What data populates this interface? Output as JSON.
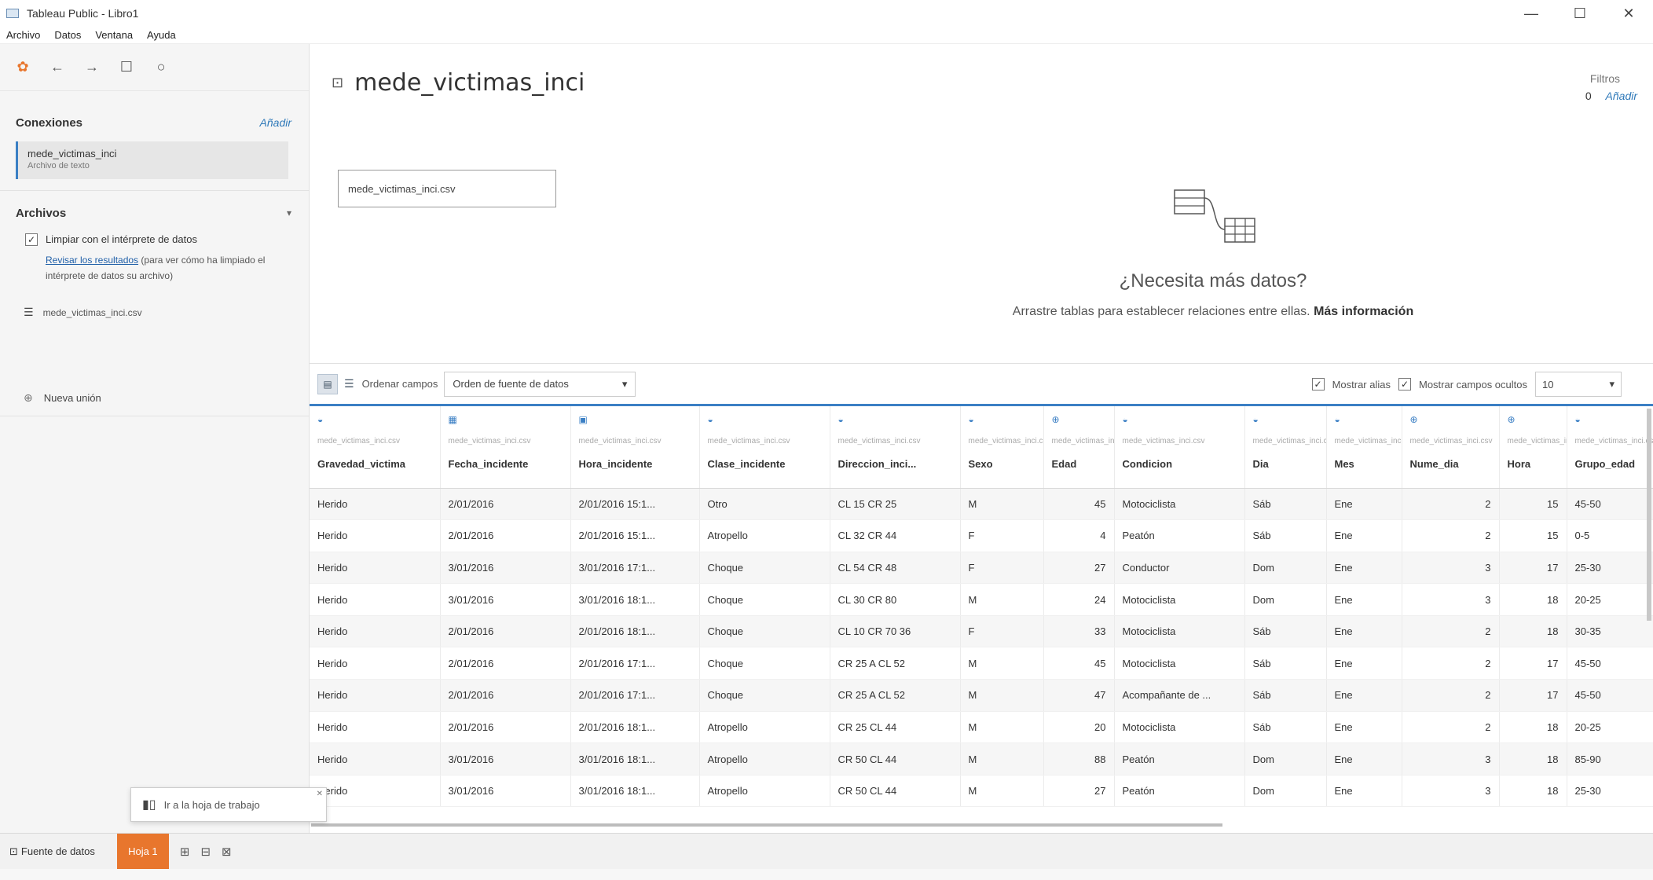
{
  "window": {
    "title": "Tableau Public - Libro1",
    "controls": [
      "—",
      "☐",
      "✕"
    ]
  },
  "menu": [
    "Archivo",
    "Datos",
    "Ventana",
    "Ayuda"
  ],
  "left": {
    "toolbar_icons": [
      "tableau-logo-icon",
      "undo-icon",
      "redo-icon",
      "save-icon",
      "refresh-icon"
    ],
    "connections_title": "Conexiones",
    "connections_add": "Añadir",
    "connection_name": "mede_victimas_inci",
    "connection_sub": "Archivo de texto",
    "files_title": "Archivos",
    "interpreter_label": "Limpiar con el intérprete de datos",
    "interpreter_hint_link": "Revisar los resultados",
    "interpreter_hint_text": " (para ver cómo ha limpiado el intérprete de datos su archivo)",
    "file_item": "mede_victimas_inci.csv",
    "new_union": "Nueva unión"
  },
  "main": {
    "title": "mede_victimas_inci",
    "filters_label": "Filtros",
    "filters_count": "0",
    "filters_add": "Añadir",
    "table_box": "mede_victimas_inci.csv",
    "need_title": "¿Necesita más datos?",
    "need_text": "Arrastre tablas para establecer relaciones entre ellas. ",
    "need_link": "Más información"
  },
  "gridbar": {
    "sort_label": "Ordenar campos",
    "sort_value": "Orden de fuente de datos",
    "show_aliases": "Mostrar alias",
    "show_hidden": "Mostrar campos ocultos",
    "rows_value": "10"
  },
  "grid": {
    "columns": [
      {
        "icon": "abc",
        "source": "mede_victimas_inci.csv",
        "name": "Gravedad_victima"
      },
      {
        "icon": "date",
        "source": "mede_victimas_inci.csv",
        "name": "Fecha_incidente"
      },
      {
        "icon": "datetime",
        "source": "mede_victimas_inci.csv",
        "name": "Hora_incidente"
      },
      {
        "icon": "abc",
        "source": "mede_victimas_inci.csv",
        "name": "Clase_incidente"
      },
      {
        "icon": "abc",
        "source": "mede_victimas_inci.csv",
        "name": "Direccion_inci..."
      },
      {
        "icon": "abc",
        "source": "mede_victimas_inci.csv",
        "name": "Sexo"
      },
      {
        "icon": "#",
        "source": "mede_victimas_inci.csv",
        "name": "Edad"
      },
      {
        "icon": "abc",
        "source": "mede_victimas_inci.csv",
        "name": "Condicion"
      },
      {
        "icon": "abc",
        "source": "mede_victimas_inci.csv",
        "name": "Dia"
      },
      {
        "icon": "abc",
        "source": "mede_victimas_inci.csv",
        "name": "Mes"
      },
      {
        "icon": "#",
        "source": "mede_victimas_inci.csv",
        "name": "Nume_dia"
      },
      {
        "icon": "#",
        "source": "mede_victimas_inci.csv",
        "name": "Hora"
      },
      {
        "icon": "abc",
        "source": "mede_victimas_inci.csv",
        "name": "Grupo_edad"
      }
    ],
    "rows": [
      [
        "Herido",
        "2/01/2016",
        "2/01/2016 15:1...",
        "Otro",
        "CL 15 CR 25",
        "M",
        "45",
        "Motociclista",
        "Sáb",
        "Ene",
        "2",
        "15",
        "45-50"
      ],
      [
        "Herido",
        "2/01/2016",
        "2/01/2016 15:1...",
        "Atropello",
        "CL 32 CR 44",
        "F",
        "4",
        "Peatón",
        "Sáb",
        "Ene",
        "2",
        "15",
        "0-5"
      ],
      [
        "Herido",
        "3/01/2016",
        "3/01/2016 17:1...",
        "Choque",
        "CL 54 CR 48",
        "F",
        "27",
        "Conductor",
        "Dom",
        "Ene",
        "3",
        "17",
        "25-30"
      ],
      [
        "Herido",
        "3/01/2016",
        "3/01/2016 18:1...",
        "Choque",
        "CL 30 CR 80",
        "M",
        "24",
        "Motociclista",
        "Dom",
        "Ene",
        "3",
        "18",
        "20-25"
      ],
      [
        "Herido",
        "2/01/2016",
        "2/01/2016 18:1...",
        "Choque",
        "CL 10 CR 70 36",
        "F",
        "33",
        "Motociclista",
        "Sáb",
        "Ene",
        "2",
        "18",
        "30-35"
      ],
      [
        "Herido",
        "2/01/2016",
        "2/01/2016 17:1...",
        "Choque",
        "CR 25 A CL 52",
        "M",
        "45",
        "Motociclista",
        "Sáb",
        "Ene",
        "2",
        "17",
        "45-50"
      ],
      [
        "Herido",
        "2/01/2016",
        "2/01/2016 17:1...",
        "Choque",
        "CR 25 A CL 52",
        "M",
        "47",
        "Acompañante de ...",
        "Sáb",
        "Ene",
        "2",
        "17",
        "45-50"
      ],
      [
        "Herido",
        "2/01/2016",
        "2/01/2016 18:1...",
        "Atropello",
        "CR 25 CL 44",
        "M",
        "20",
        "Motociclista",
        "Sáb",
        "Ene",
        "2",
        "18",
        "20-25"
      ],
      [
        "Herido",
        "3/01/2016",
        "3/01/2016 18:1...",
        "Atropello",
        "CR 50 CL 44",
        "M",
        "88",
        "Peatón",
        "Dom",
        "Ene",
        "3",
        "18",
        "85-90"
      ],
      [
        "Herido",
        "3/01/2016",
        "3/01/2016 18:1...",
        "Atropello",
        "CR 50 CL 44",
        "M",
        "27",
        "Peatón",
        "Dom",
        "Ene",
        "3",
        "18",
        "25-30"
      ]
    ]
  },
  "tooltip": {
    "text": "Ir a la hoja de trabajo"
  },
  "tabs": {
    "datasource": "Fuente de datos",
    "sheet": "Hoja 1"
  }
}
